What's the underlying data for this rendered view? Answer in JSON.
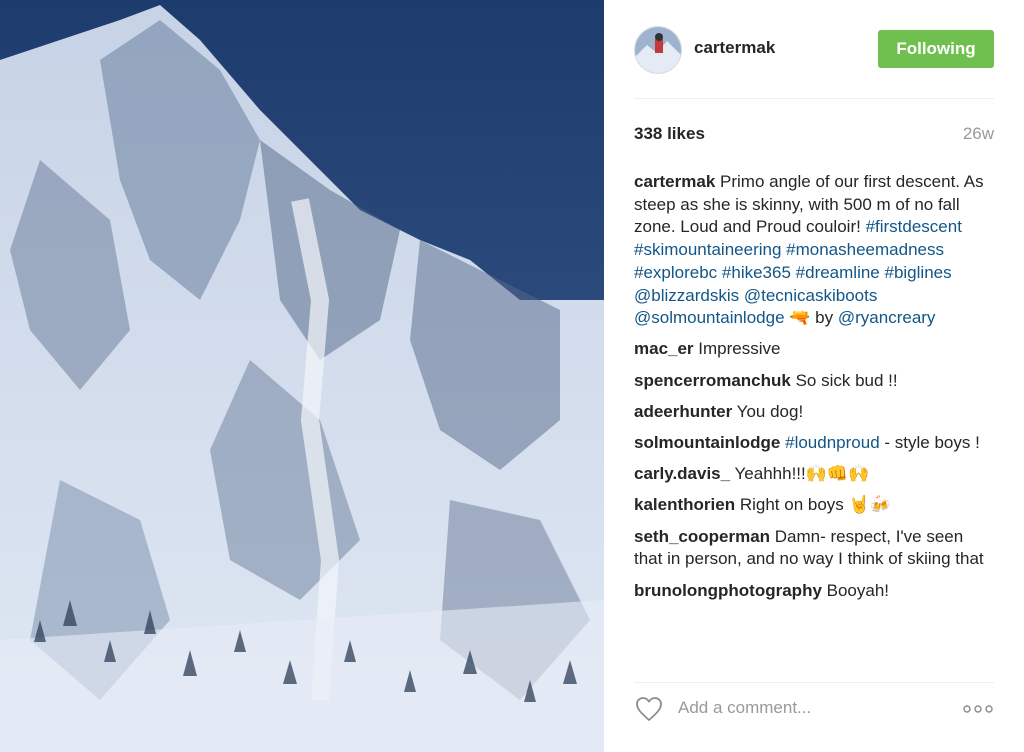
{
  "post": {
    "username": "cartermak",
    "follow_label": "Following",
    "likes": "338 likes",
    "age": "26w"
  },
  "caption": {
    "user": "cartermak",
    "text": "Primo angle of our first descent. As steep as she is skinny, with 500 m of no fall zone. Loud and Proud couloir!",
    "tags": [
      "#firstdescent",
      "#skimountaineering",
      "#monasheemadness",
      "#explorebc",
      "#hike365",
      "#dreamline",
      "#biglines",
      "@blizzardskis",
      "@tecnicaskiboots",
      "@solmountainlodge"
    ],
    "emoji": "🔫",
    "by_text": "by",
    "credit": "@ryancreary"
  },
  "comments": [
    {
      "user": "mac_er",
      "text": "Impressive"
    },
    {
      "user": "spencerromanchuk",
      "text": "So sick bud !!"
    },
    {
      "user": "adeerhunter",
      "text": "You dog!"
    },
    {
      "user": "solmountainlodge",
      "tag": "#loudnproud",
      "text": "- style boys !"
    },
    {
      "user": "carly.davis_",
      "text": "Yeahhh!!!🙌👊🙌"
    },
    {
      "user": "kalenthorien",
      "text": "Right on boys 🤘🍻"
    },
    {
      "user": "seth_cooperman",
      "text": "Damn- respect, I've seen that in person, and no way I think of skiing that"
    },
    {
      "user": "brunolongphotography",
      "text": "Booyah!"
    }
  ],
  "composer": {
    "placeholder": "Add a comment...",
    "heart_icon": "heart-outline-icon",
    "more_icon": "more-options-icon"
  },
  "colors": {
    "follow_bg": "#70c050",
    "link": "#125688",
    "muted": "#999999"
  }
}
